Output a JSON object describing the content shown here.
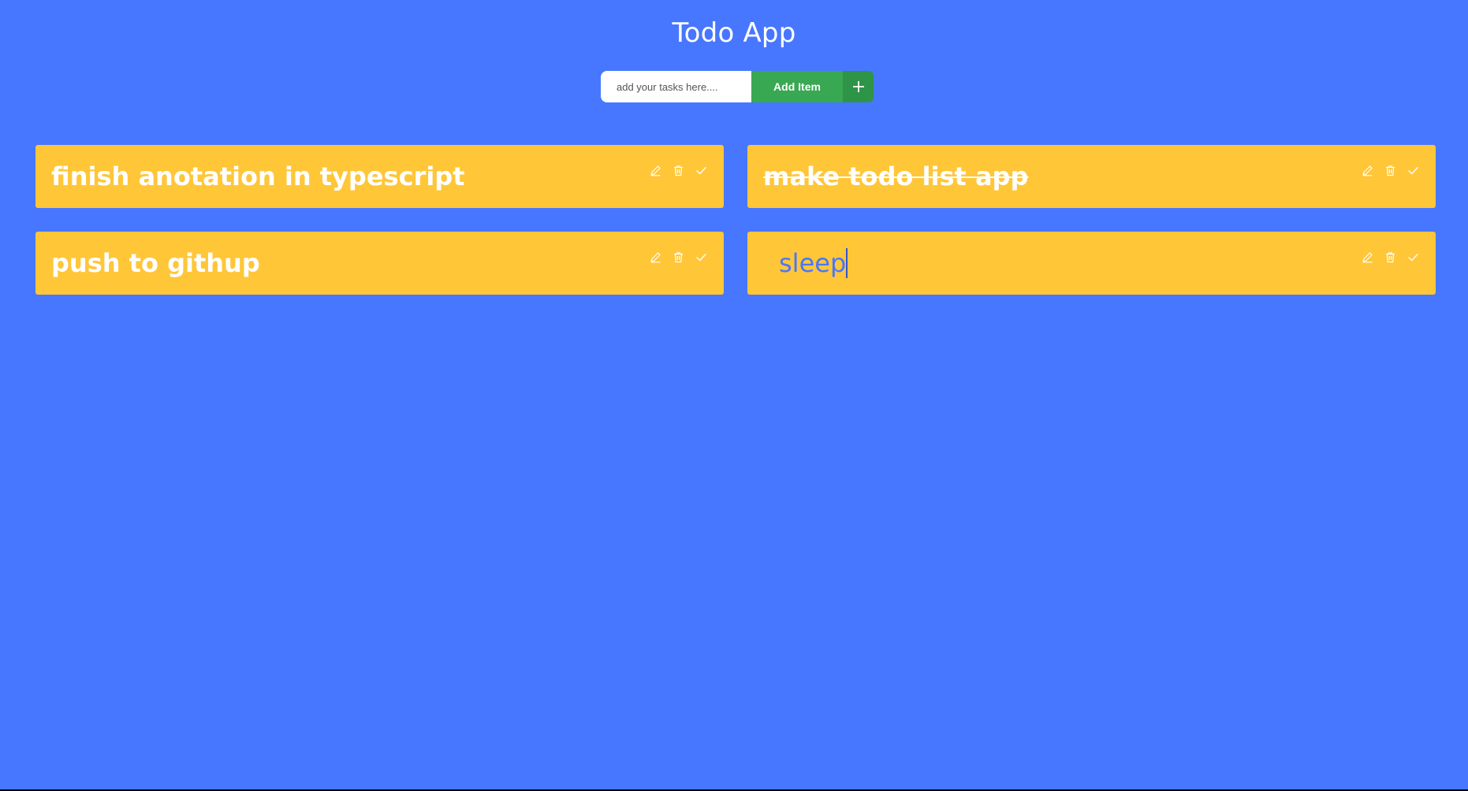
{
  "app": {
    "title": "Todo App"
  },
  "add_form": {
    "placeholder": "add your tasks here....",
    "value": "",
    "button_label": "Add Item",
    "icon": "plus-icon"
  },
  "todos": [
    {
      "text": "finish anotation in typescript",
      "completed": false,
      "editing": false
    },
    {
      "text": "make todo list app",
      "completed": true,
      "editing": false
    },
    {
      "text": "push to githup",
      "completed": false,
      "editing": false
    },
    {
      "text": "sleep",
      "completed": false,
      "editing": true
    }
  ],
  "todo_actions": [
    "edit-icon",
    "trash-icon",
    "check-icon"
  ],
  "colors": {
    "background": "#4877ff",
    "card": "#ffc638",
    "add_button": "#38a852",
    "add_icon_bg": "#2e9447",
    "text": "#ffffff",
    "edit_text": "#4877ff"
  }
}
